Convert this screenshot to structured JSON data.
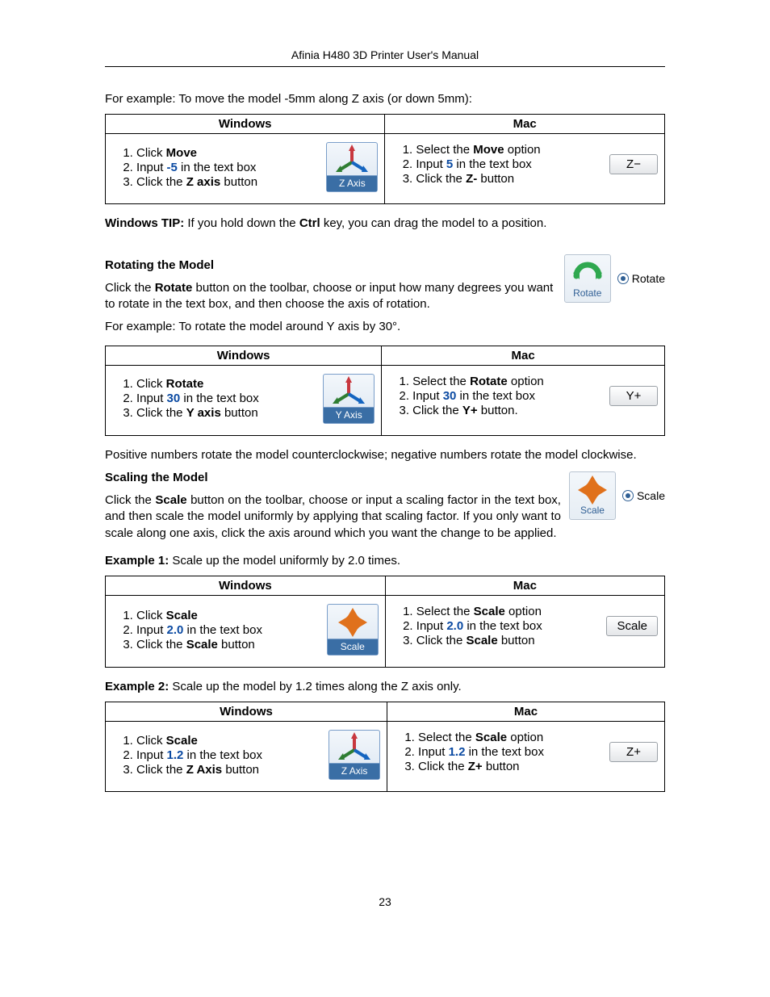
{
  "header": {
    "title": "Afinia H480 3D Printer User's Manual"
  },
  "intro_move": "For example: To move the model -5mm along Z axis (or down 5mm):",
  "col": {
    "win": "Windows",
    "mac": "Mac"
  },
  "move": {
    "win": {
      "s1a": "Click ",
      "s1b": "Move",
      "s2a": "Input ",
      "s2v": "-5",
      "s2b": " in the text box",
      "s3a": "Click the ",
      "s3b": "Z axis",
      "s3c": " button",
      "btn": "Z Axis"
    },
    "mac": {
      "s1a": "Select the ",
      "s1b": "Move",
      "s1c": " option",
      "s2a": "Input ",
      "s2v": "5",
      "s2b": " in the text box",
      "s3a": "Click the ",
      "s3b": "Z-",
      "s3c": " button",
      "btn": "Z−"
    }
  },
  "tip": {
    "a": "Windows TIP:",
    "b": " If you hold down the ",
    "c": "Ctrl",
    "d": " key, you can drag the model to a position."
  },
  "rotate": {
    "heading": "Rotating the Model",
    "p1a": "Click the ",
    "p1b": "Rotate",
    "p1c": " button on the toolbar, choose or input how many degrees you want to rotate in the text box, and then choose the axis of rotation.",
    "ex_intro": "For example: To rotate the model around Y axis by 30°.",
    "radio": "Rotate",
    "tool_label": "Rotate",
    "win": {
      "s1a": "Click ",
      "s1b": "Rotate",
      "s2a": "Input ",
      "s2v": "30",
      "s2b": " in the text box",
      "s3a": "Click the ",
      "s3b": "Y axis",
      "s3c": " button",
      "btn": "Y Axis"
    },
    "mac": {
      "s1a": "Select the ",
      "s1b": "Rotate",
      "s1c": " option",
      "s2a": "Input ",
      "s2v": "30",
      "s2b": " in the text box",
      "s3a": "Click the ",
      "s3b": "Y+",
      "s3c": " button.",
      "btn": "Y+"
    },
    "note": "Positive numbers rotate the model counterclockwise; negative numbers rotate the model clockwise."
  },
  "scale": {
    "heading": "Scaling the Model",
    "p1a": "Click the ",
    "p1b": "Scale",
    "p1c": " button on the toolbar, choose or input a scaling factor in the text box, and then scale the model uniformly by applying that scaling factor. If you only want to scale along one axis, click the axis around which you want the change to be applied.",
    "radio": "Scale",
    "tool_label": "Scale",
    "ex1": {
      "a": "Example 1:",
      "b": " Scale up the model uniformly by 2.0 times."
    },
    "ex1_win": {
      "s1a": "Click ",
      "s1b": "Scale",
      "s2a": "Input ",
      "s2v": "2.0",
      "s2b": " in the text box",
      "s3a": "Click the ",
      "s3b": "Scale",
      "s3c": " button",
      "btn": "Scale"
    },
    "ex1_mac": {
      "s1a": "Select the ",
      "s1b": "Scale",
      "s1c": " option",
      "s2a": "Input ",
      "s2v": "2.0",
      "s2b": " in the text box",
      "s3a": "Click the ",
      "s3b": "Scale",
      "s3c": " button",
      "btn": "Scale"
    },
    "ex2": {
      "a": "Example 2:",
      "b": " Scale up the model by 1.2 times along the Z axis only."
    },
    "ex2_win": {
      "s1a": "Click ",
      "s1b": "Scale",
      "s2a": "Input ",
      "s2v": "1.2",
      "s2b": " in the text box",
      "s3a": "Click the ",
      "s3b": "Z Axis",
      "s3c": " button",
      "btn": "Z Axis"
    },
    "ex2_mac": {
      "s1a": "Select the ",
      "s1b": "Scale",
      "s1c": " option",
      "s2a": "Input ",
      "s2v": "1.2",
      "s2b": " in the text box",
      "s3a": "Click the ",
      "s3b": "Z+",
      "s3c": " button",
      "btn": "Z+"
    }
  },
  "page_number": "23"
}
